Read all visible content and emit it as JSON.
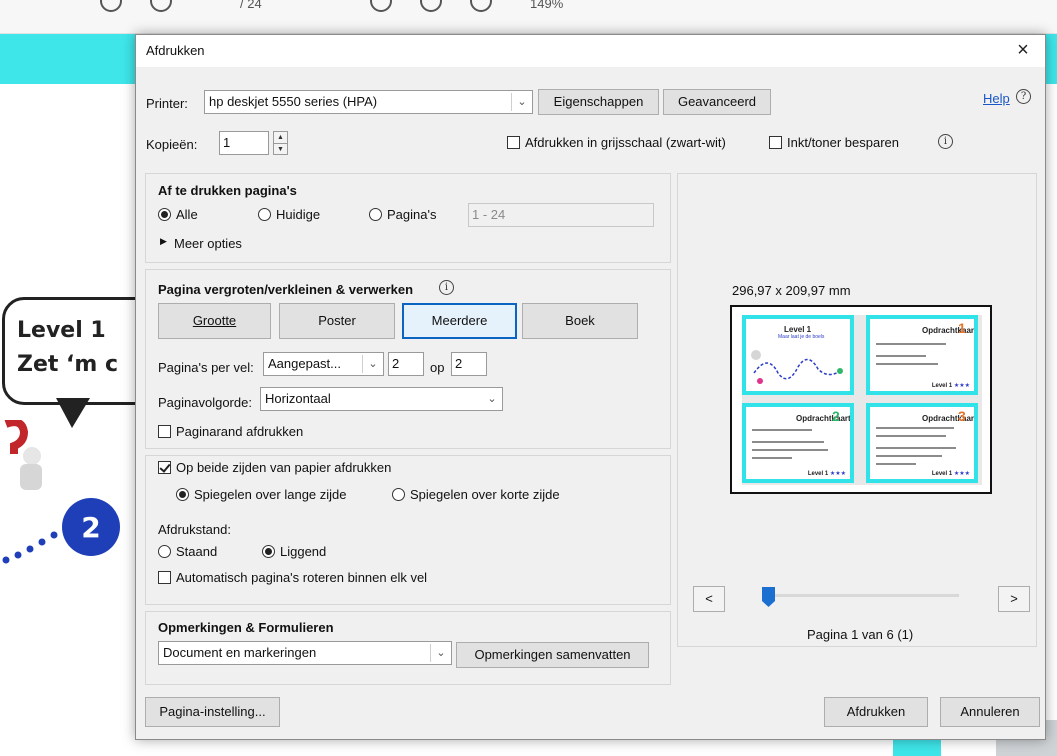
{
  "background": {
    "toolbar_zoom": "149%",
    "toolbar_page": "/ 24",
    "bubble_line1": "Level 1",
    "bubble_line2": "Zet ‘m c",
    "step_number": "2"
  },
  "dialog": {
    "title": "Afdrukken",
    "close": "×",
    "printer_label": "Printer:",
    "printer_value": "hp deskjet 5550 series (HPA)",
    "properties_button": "Eigenschappen",
    "advanced_button": "Geavanceerd",
    "help_link": "Help",
    "copies_label": "Kopieën:",
    "copies_value": "1",
    "grayscale_label": "Afdrukken in grijsschaal (zwart-wit)",
    "grayscale_checked": false,
    "save_ink_label": "Inkt/toner besparen",
    "save_ink_checked": false,
    "pages": {
      "heading": "Af te drukken pagina's",
      "all": "Alle",
      "current": "Huidige",
      "pages_option": "Pagina's",
      "range_value": "1 - 24",
      "selected": "all",
      "more_options": "Meer opties"
    },
    "sizing": {
      "heading": "Pagina vergroten/verkleinen & verwerken",
      "buttons": [
        "Grootte",
        "Poster",
        "Meerdere",
        "Boek"
      ],
      "active": "Meerdere",
      "pages_per_sheet_label": "Pagina's per vel:",
      "pages_per_sheet_value": "Aangepast...",
      "cols": "2",
      "op_label": "op",
      "rows": "2",
      "page_order_label": "Paginavolgorde:",
      "page_order_value": "Horizontaal",
      "print_border_label": "Paginarand afdrukken",
      "print_border_checked": false
    },
    "duplex": {
      "both_sides_label": "Op beide zijden van papier afdrukken",
      "both_sides_checked": true,
      "long_edge": "Spiegelen over lange zijde",
      "short_edge": "Spiegelen over korte zijde",
      "flip_selected": "long",
      "orientation_label": "Afdrukstand:",
      "portrait": "Staand",
      "landscape": "Liggend",
      "orientation_selected": "landscape",
      "auto_rotate_label": "Automatisch pagina's roteren binnen elk vel",
      "auto_rotate_checked": false
    },
    "comments": {
      "heading": "Opmerkingen & Formulieren",
      "select_value": "Document en markeringen",
      "summarize_button": "Opmerkingen samenvatten"
    },
    "preview": {
      "size_label": "296,97 x 209,97 mm",
      "prev": "<",
      "next": ">",
      "page_label": "Pagina 1 van 6 (1)",
      "slider_position": 0.0,
      "thumbnails": [
        {
          "title": "Level 1",
          "subtitle": "Maar laat je de boels",
          "number": ""
        },
        {
          "title": "Opdrachtkaart",
          "number": "1",
          "footer": "Level 1"
        },
        {
          "title": "Opdrachtkaart",
          "number": "2",
          "footer": "Level 1"
        },
        {
          "title": "Opdrachtkaart",
          "number": "3",
          "footer": "Level 1"
        }
      ],
      "stars": "★★★",
      "accent_color": "#31e3e9"
    },
    "page_setup_button": "Pagina-instelling...",
    "print_button": "Afdrukken",
    "cancel_button": "Annuleren"
  }
}
